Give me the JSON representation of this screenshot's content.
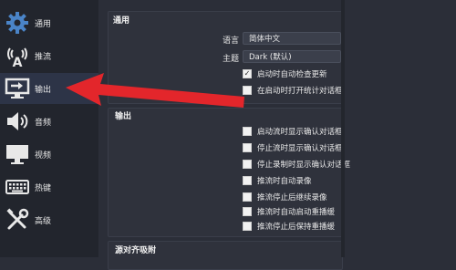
{
  "sidebar": {
    "items": [
      {
        "label": "通用",
        "icon": "gear-icon",
        "active": false
      },
      {
        "label": "推流",
        "icon": "stream-antenna-icon",
        "active": false
      },
      {
        "label": "输出",
        "icon": "output-monitor-icon",
        "active": true
      },
      {
        "label": "音频",
        "icon": "speaker-icon",
        "active": false
      },
      {
        "label": "视频",
        "icon": "monitor-icon",
        "active": false
      },
      {
        "label": "热键",
        "icon": "keyboard-icon",
        "active": false
      },
      {
        "label": "高级",
        "icon": "tools-icon",
        "active": false
      }
    ]
  },
  "general": {
    "title": "通用",
    "language_label": "语言",
    "language_value": "简体中文",
    "theme_label": "主题",
    "theme_value": "Dark (默认)",
    "checkboxes": [
      {
        "label": "启动时自动检查更新",
        "checked": true
      },
      {
        "label": "在启动时打开统计对话框",
        "checked": false
      }
    ]
  },
  "output": {
    "title": "输出",
    "checkboxes": [
      {
        "label": "启动流时显示确认对话框",
        "checked": false
      },
      {
        "label": "停止流时显示确认对话框",
        "checked": false
      },
      {
        "label": "停止录制时显示确认对话框",
        "checked": false
      },
      {
        "label": "推流时自动录像",
        "checked": false
      },
      {
        "label": "推流停止后继续录像",
        "checked": false
      },
      {
        "label": "推流时自动启动重播缓",
        "checked": false
      },
      {
        "label": "推流停止后保持重播缓",
        "checked": false
      }
    ]
  },
  "snapping": {
    "title": "源对齐吸附"
  },
  "annotation": {
    "arrow_color": "#e3262b"
  }
}
